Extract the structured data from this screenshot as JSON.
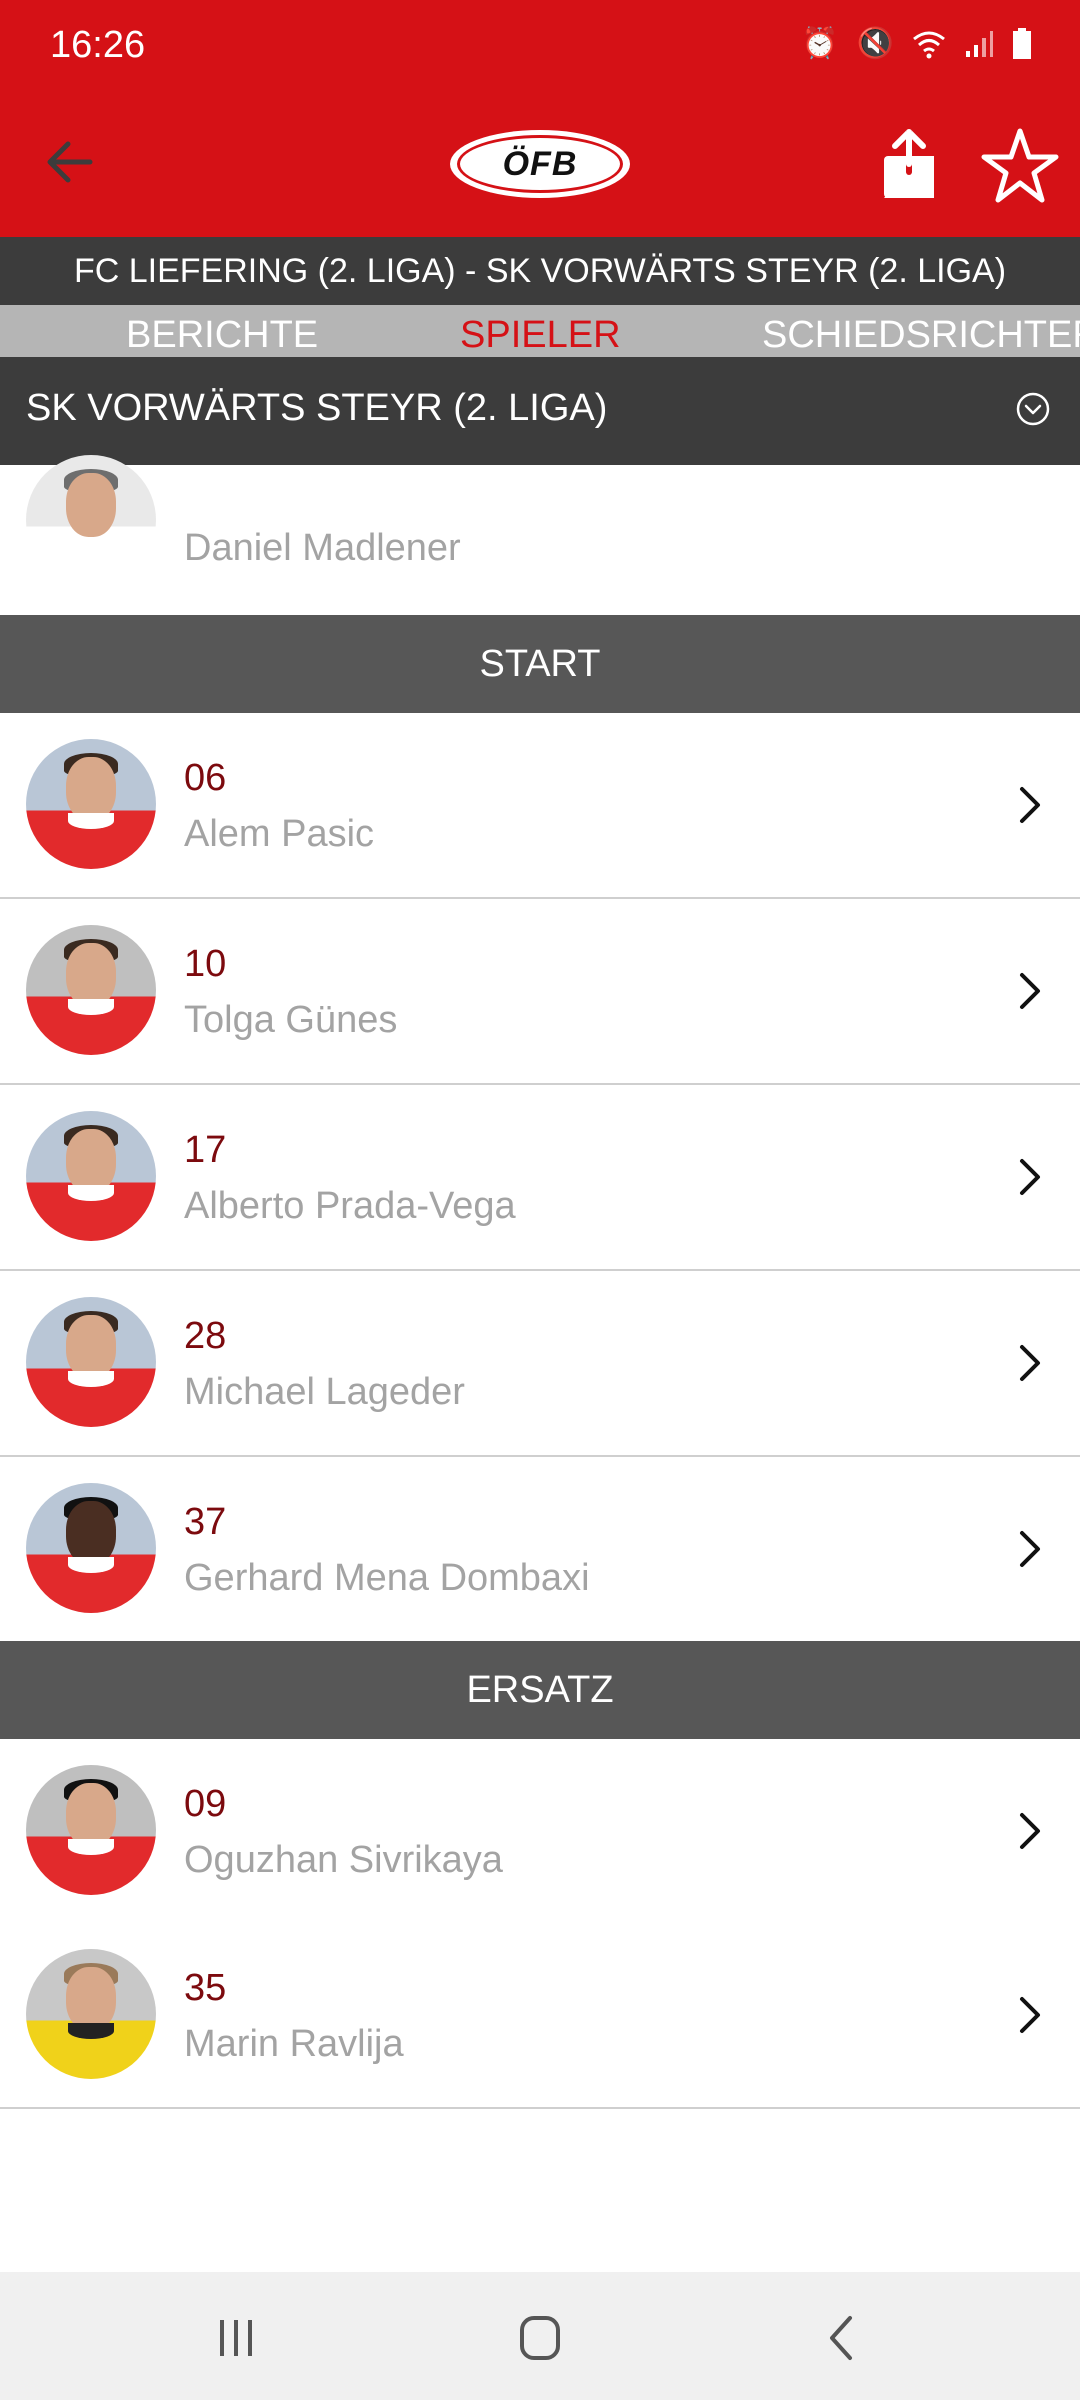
{
  "status_bar": {
    "time": "16:26",
    "icons": [
      "alarm-icon",
      "mute-icon",
      "wifi-icon",
      "signal-icon",
      "battery-icon"
    ]
  },
  "app_bar": {
    "logo_text": "ÖFB",
    "icons": [
      "back-arrow-icon",
      "share-icon",
      "star-icon"
    ]
  },
  "match_title": "FC LIEFERING (2. LIGA) - SK VORWÄRTS STEYR (2. LIGA)",
  "tabs": [
    {
      "label": "BERICHTE",
      "active": false
    },
    {
      "label": "SPIELER",
      "active": true
    },
    {
      "label": "SCHIEDSRICHTER",
      "active": false
    }
  ],
  "team_selector": {
    "label": "SK VORWÄRTS STEYR (2. LIGA)",
    "icon": "chevron-down-circle-icon"
  },
  "coach": {
    "name": "Daniel Madlener"
  },
  "sections": [
    {
      "title": "START",
      "players": [
        {
          "number": "06",
          "name": "Alem Pasic"
        },
        {
          "number": "10",
          "name": "Tolga Günes"
        },
        {
          "number": "17",
          "name": "Alberto Prada-Vega"
        },
        {
          "number": "28",
          "name": "Michael Lageder"
        },
        {
          "number": "37",
          "name": "Gerhard Mena Dombaxi"
        }
      ]
    },
    {
      "title": "ERSATZ",
      "players": [
        {
          "number": "09",
          "name": "Oguzhan Sivrikaya"
        },
        {
          "number": "35",
          "name": "Marin Ravlija"
        }
      ]
    }
  ],
  "colors": {
    "brand_red": "#d51116",
    "dark_bar": "#3c3c3c",
    "section_bg": "#575757",
    "number_color": "#7c0a0e",
    "name_color": "#a3a3a3"
  },
  "nav_bar": {
    "icons": [
      "recent-apps-icon",
      "home-icon",
      "back-icon"
    ]
  }
}
